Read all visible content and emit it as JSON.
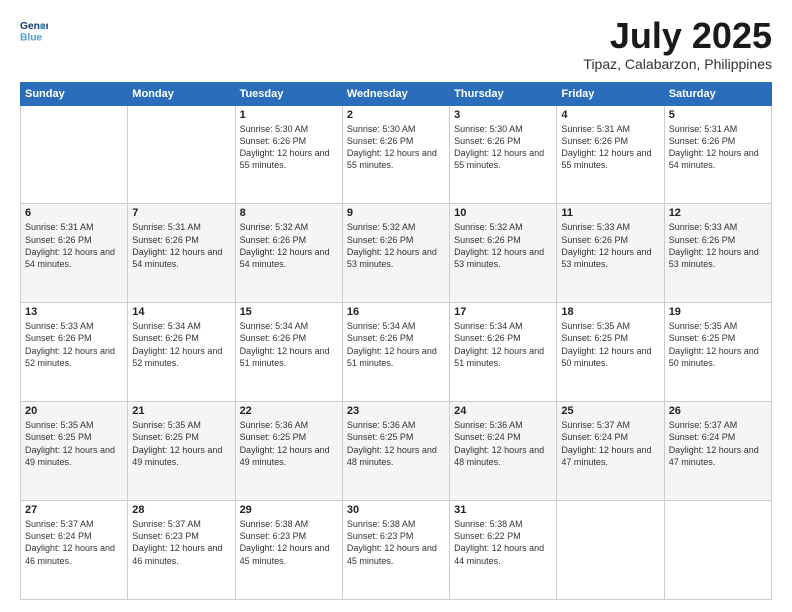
{
  "header": {
    "logo_line1": "General",
    "logo_line2": "Blue",
    "month": "July 2025",
    "location": "Tipaz, Calabarzon, Philippines"
  },
  "days_of_week": [
    "Sunday",
    "Monday",
    "Tuesday",
    "Wednesday",
    "Thursday",
    "Friday",
    "Saturday"
  ],
  "weeks": [
    [
      {
        "day": "",
        "info": ""
      },
      {
        "day": "",
        "info": ""
      },
      {
        "day": "1",
        "sunrise": "5:30 AM",
        "sunset": "6:26 PM",
        "daylight": "12 hours and 55 minutes."
      },
      {
        "day": "2",
        "sunrise": "5:30 AM",
        "sunset": "6:26 PM",
        "daylight": "12 hours and 55 minutes."
      },
      {
        "day": "3",
        "sunrise": "5:30 AM",
        "sunset": "6:26 PM",
        "daylight": "12 hours and 55 minutes."
      },
      {
        "day": "4",
        "sunrise": "5:31 AM",
        "sunset": "6:26 PM",
        "daylight": "12 hours and 55 minutes."
      },
      {
        "day": "5",
        "sunrise": "5:31 AM",
        "sunset": "6:26 PM",
        "daylight": "12 hours and 54 minutes."
      }
    ],
    [
      {
        "day": "6",
        "sunrise": "5:31 AM",
        "sunset": "6:26 PM",
        "daylight": "12 hours and 54 minutes."
      },
      {
        "day": "7",
        "sunrise": "5:31 AM",
        "sunset": "6:26 PM",
        "daylight": "12 hours and 54 minutes."
      },
      {
        "day": "8",
        "sunrise": "5:32 AM",
        "sunset": "6:26 PM",
        "daylight": "12 hours and 54 minutes."
      },
      {
        "day": "9",
        "sunrise": "5:32 AM",
        "sunset": "6:26 PM",
        "daylight": "12 hours and 53 minutes."
      },
      {
        "day": "10",
        "sunrise": "5:32 AM",
        "sunset": "6:26 PM",
        "daylight": "12 hours and 53 minutes."
      },
      {
        "day": "11",
        "sunrise": "5:33 AM",
        "sunset": "6:26 PM",
        "daylight": "12 hours and 53 minutes."
      },
      {
        "day": "12",
        "sunrise": "5:33 AM",
        "sunset": "6:26 PM",
        "daylight": "12 hours and 53 minutes."
      }
    ],
    [
      {
        "day": "13",
        "sunrise": "5:33 AM",
        "sunset": "6:26 PM",
        "daylight": "12 hours and 52 minutes."
      },
      {
        "day": "14",
        "sunrise": "5:34 AM",
        "sunset": "6:26 PM",
        "daylight": "12 hours and 52 minutes."
      },
      {
        "day": "15",
        "sunrise": "5:34 AM",
        "sunset": "6:26 PM",
        "daylight": "12 hours and 51 minutes."
      },
      {
        "day": "16",
        "sunrise": "5:34 AM",
        "sunset": "6:26 PM",
        "daylight": "12 hours and 51 minutes."
      },
      {
        "day": "17",
        "sunrise": "5:34 AM",
        "sunset": "6:26 PM",
        "daylight": "12 hours and 51 minutes."
      },
      {
        "day": "18",
        "sunrise": "5:35 AM",
        "sunset": "6:25 PM",
        "daylight": "12 hours and 50 minutes."
      },
      {
        "day": "19",
        "sunrise": "5:35 AM",
        "sunset": "6:25 PM",
        "daylight": "12 hours and 50 minutes."
      }
    ],
    [
      {
        "day": "20",
        "sunrise": "5:35 AM",
        "sunset": "6:25 PM",
        "daylight": "12 hours and 49 minutes."
      },
      {
        "day": "21",
        "sunrise": "5:35 AM",
        "sunset": "6:25 PM",
        "daylight": "12 hours and 49 minutes."
      },
      {
        "day": "22",
        "sunrise": "5:36 AM",
        "sunset": "6:25 PM",
        "daylight": "12 hours and 49 minutes."
      },
      {
        "day": "23",
        "sunrise": "5:36 AM",
        "sunset": "6:25 PM",
        "daylight": "12 hours and 48 minutes."
      },
      {
        "day": "24",
        "sunrise": "5:36 AM",
        "sunset": "6:24 PM",
        "daylight": "12 hours and 48 minutes."
      },
      {
        "day": "25",
        "sunrise": "5:37 AM",
        "sunset": "6:24 PM",
        "daylight": "12 hours and 47 minutes."
      },
      {
        "day": "26",
        "sunrise": "5:37 AM",
        "sunset": "6:24 PM",
        "daylight": "12 hours and 47 minutes."
      }
    ],
    [
      {
        "day": "27",
        "sunrise": "5:37 AM",
        "sunset": "6:24 PM",
        "daylight": "12 hours and 46 minutes."
      },
      {
        "day": "28",
        "sunrise": "5:37 AM",
        "sunset": "6:23 PM",
        "daylight": "12 hours and 46 minutes."
      },
      {
        "day": "29",
        "sunrise": "5:38 AM",
        "sunset": "6:23 PM",
        "daylight": "12 hours and 45 minutes."
      },
      {
        "day": "30",
        "sunrise": "5:38 AM",
        "sunset": "6:23 PM",
        "daylight": "12 hours and 45 minutes."
      },
      {
        "day": "31",
        "sunrise": "5:38 AM",
        "sunset": "6:22 PM",
        "daylight": "12 hours and 44 minutes."
      },
      {
        "day": "",
        "info": ""
      },
      {
        "day": "",
        "info": ""
      }
    ]
  ]
}
